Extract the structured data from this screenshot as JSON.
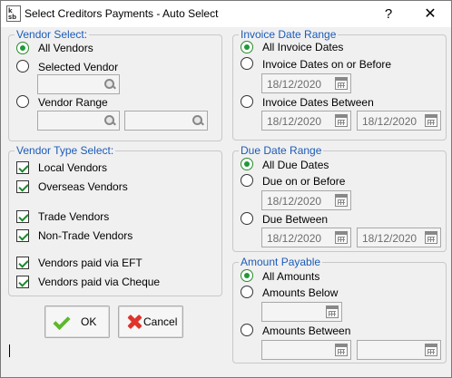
{
  "window": {
    "title": "Select Creditors Payments - Auto Select",
    "help_label": "?",
    "close_label": "✕"
  },
  "vendor_select": {
    "legend": "Vendor Select:",
    "all_vendors": "All Vendors",
    "selected_vendor": "Selected Vendor",
    "vendor_range": "Vendor Range",
    "selected": "all_vendors",
    "selected_vendor_value": "",
    "range_from_value": "",
    "range_to_value": ""
  },
  "vendor_type": {
    "legend": "Vendor Type Select:",
    "local": "Local Vendors",
    "overseas": "Overseas Vendors",
    "trade": "Trade Vendors",
    "non_trade": "Non-Trade Vendors",
    "eft": "Vendors paid via EFT",
    "cheque": "Vendors paid via Cheque",
    "checked": [
      "local",
      "overseas",
      "trade",
      "non_trade",
      "eft",
      "cheque"
    ]
  },
  "invoice_date": {
    "legend": "Invoice Date Range",
    "all": "All Invoice Dates",
    "on_or_before": "Invoice Dates on or Before",
    "between": "Invoice Dates Between",
    "on_or_before_value": "18/12/2020",
    "between_from": "18/12/2020",
    "between_to": "18/12/2020",
    "selected": "all"
  },
  "due_date": {
    "legend": "Due Date Range",
    "all": "All Due Dates",
    "on_or_before": "Due on or Before",
    "between": "Due Between",
    "on_or_before_value": "18/12/2020",
    "between_from": "18/12/2020",
    "between_to": "18/12/2020",
    "selected": "all"
  },
  "amount": {
    "legend": "Amount Payable",
    "all": "All Amounts",
    "below": "Amounts Below",
    "between": "Amounts Between",
    "below_value": "",
    "between_from": "",
    "between_to": "",
    "selected": "all"
  },
  "buttons": {
    "ok": "OK",
    "cancel": "Cancel"
  },
  "icons": {
    "app": "app-icon",
    "ok": "checkmark-icon",
    "cancel": "cross-icon",
    "lookup": "magnifier-icon",
    "calendar": "calendar-icon"
  },
  "colors": {
    "legend": "#1c5bb8",
    "radio_selected": "#1e9a3a",
    "ok_icon": "#5cb82c",
    "cancel_icon": "#e0332b"
  }
}
